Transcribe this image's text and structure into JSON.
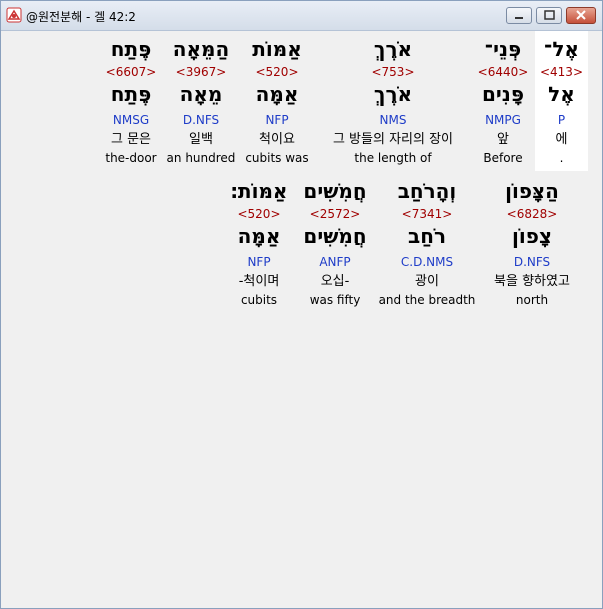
{
  "window": {
    "title": "@원전분해 - 겔 42:2"
  },
  "rows": [
    {
      "words": [
        {
          "heb": "אֶל־",
          "strong": "<413>",
          "lemma": "אֶל",
          "morph": "P",
          "kor": "에",
          "eng": ".",
          "selected": true
        },
        {
          "heb": "פְּנֵי־",
          "strong": "<6440>",
          "lemma": "פָּנִים",
          "morph": "NMPG",
          "kor": "앞",
          "eng": "Before"
        },
        {
          "heb": "אֹרֶךְ",
          "strong": "<753>",
          "lemma": "אֹרֶךְ",
          "morph": "NMS",
          "kor": "그 방들의 자리의 장이",
          "eng": "the length of"
        },
        {
          "heb": "אַמּוֹת",
          "strong": "<520>",
          "lemma": "אַמָּה",
          "morph": "NFP",
          "kor": "척이요",
          "eng": "cubits was"
        },
        {
          "heb": "הַמֵּאָה",
          "strong": "<3967>",
          "lemma": "מֵאָה",
          "morph": "D.NFS",
          "kor": "일백",
          "eng": "an hundred"
        },
        {
          "heb": "פֶּתַח",
          "strong": "<6607>",
          "lemma": "פֶּתַח",
          "morph": "NMSG",
          "kor": "그 문은",
          "eng": "the-door"
        }
      ]
    },
    {
      "words": [
        {
          "heb": "הַצָּפוֹן",
          "strong": "<6828>",
          "lemma": "צָפוֹן",
          "morph": "D.NFS",
          "kor": "북을 향하였고",
          "eng": "north"
        },
        {
          "heb": "וְהָרֹחַב",
          "strong": "<7341>",
          "lemma": "רֹחַב",
          "morph": "C.D.NMS",
          "kor": "광이",
          "eng": "and the breadth"
        },
        {
          "heb": "חֲמִשִּׁים",
          "strong": "<2572>",
          "lemma": "חֲמִשִּׁים",
          "morph": "ANFP",
          "kor": "오십-",
          "eng": "was fifty"
        },
        {
          "heb": "אַמּוֹת׃",
          "strong": "<520>",
          "lemma": "אַמָּה",
          "morph": "NFP",
          "kor": "-척이며",
          "eng": "cubits"
        }
      ]
    }
  ]
}
